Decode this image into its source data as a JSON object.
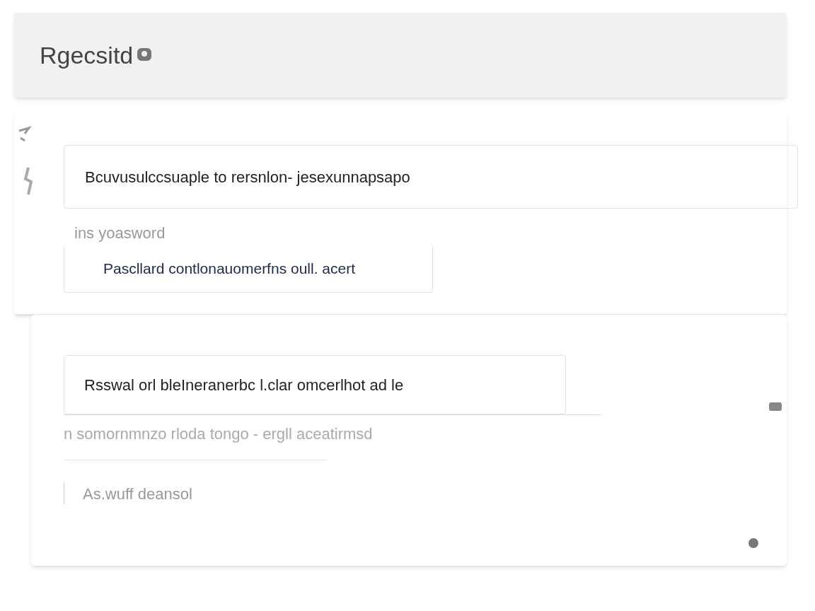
{
  "header": {
    "title": "Rgecsitd"
  },
  "section_1": {
    "field_value": "Bcuvusulccsuaple to rersnlon- jesexunnapsapo",
    "label": "ins yoasword",
    "field_2_value": "Pascllard contlonauomerfns oull. acert"
  },
  "section_2": {
    "field_value": "Rsswal orl bleIneranerbc l.clar omcerlhot ad le",
    "helper": "n somornmnzo rloda tongo - ergll aceatirmsd",
    "field_2_placeholder": "As.wuff deansol"
  }
}
